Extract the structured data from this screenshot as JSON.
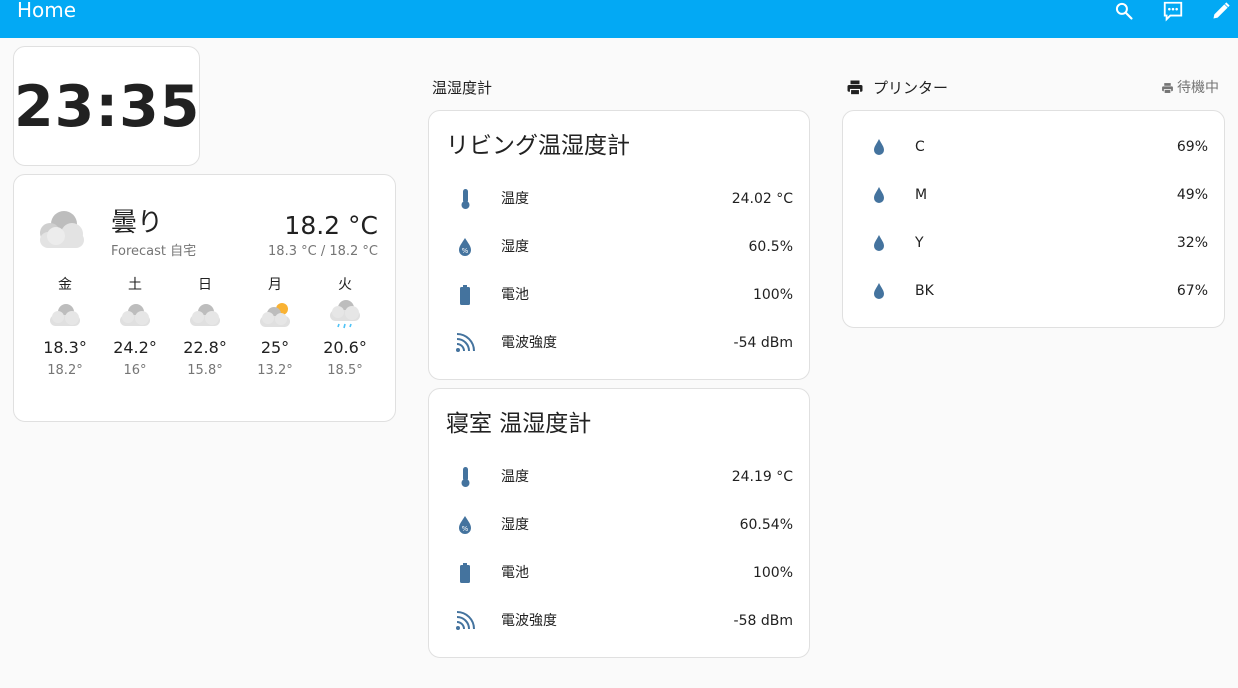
{
  "header": {
    "title": "Home"
  },
  "clock": {
    "time": "23:35"
  },
  "weather": {
    "condition": "曇り",
    "forecast_label": "Forecast 自宅",
    "temperature": "18.2 °C",
    "high_low": "18.3 °C / 18.2 °C",
    "forecast": [
      {
        "day": "金",
        "icon": "cloudy-icon",
        "high": "18.3°",
        "low": "18.2°"
      },
      {
        "day": "土",
        "icon": "cloudy-icon",
        "high": "24.2°",
        "low": "16°"
      },
      {
        "day": "日",
        "icon": "cloudy-icon",
        "high": "22.8°",
        "low": "15.8°"
      },
      {
        "day": "月",
        "icon": "partly-cloudy-icon",
        "high": "25°",
        "low": "13.2°"
      },
      {
        "day": "火",
        "icon": "rainy-icon",
        "high": "20.6°",
        "low": "18.5°"
      }
    ]
  },
  "sensors": {
    "section_title": "温湿度計",
    "cards": [
      {
        "title": "リビング温湿度計",
        "rows": [
          {
            "icon": "thermometer-icon",
            "label": "温度",
            "value": "24.02 °C"
          },
          {
            "icon": "humidity-icon",
            "label": "湿度",
            "value": "60.5%"
          },
          {
            "icon": "battery-icon",
            "label": "電池",
            "value": "100%"
          },
          {
            "icon": "signal-icon",
            "label": "電波強度",
            "value": "-54 dBm"
          }
        ]
      },
      {
        "title": "寝室 温湿度計",
        "rows": [
          {
            "icon": "thermometer-icon",
            "label": "温度",
            "value": "24.19 °C"
          },
          {
            "icon": "humidity-icon",
            "label": "湿度",
            "value": "60.54%"
          },
          {
            "icon": "battery-icon",
            "label": "電池",
            "value": "100%"
          },
          {
            "icon": "signal-icon",
            "label": "電波強度",
            "value": "-58 dBm"
          }
        ]
      }
    ]
  },
  "printer": {
    "section_title": "プリンター",
    "status": "待機中",
    "inks": [
      {
        "label": "C",
        "value": "69%"
      },
      {
        "label": "M",
        "value": "49%"
      },
      {
        "label": "Y",
        "value": "32%"
      },
      {
        "label": "BK",
        "value": "67%"
      }
    ]
  },
  "colors": {
    "header": "#03a9f4",
    "icon": "#44739e",
    "sun": "#f9b233",
    "rain": "#4fc3f7"
  }
}
